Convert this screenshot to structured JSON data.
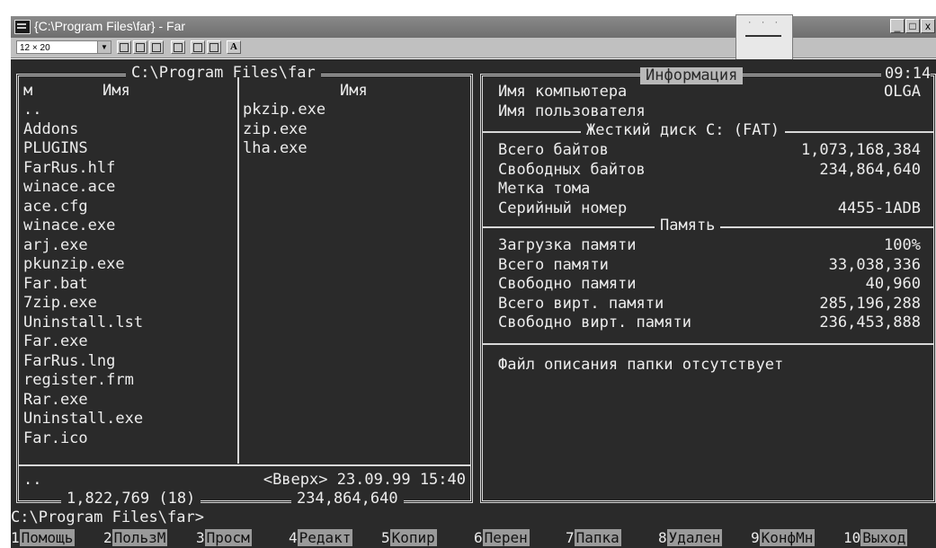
{
  "window": {
    "title": "{C:\\Program Files\\far} - Far",
    "minimize": "_",
    "maximize": "□",
    "close": "x"
  },
  "toolbar": {
    "font_size": "12 × 20"
  },
  "left_panel": {
    "title": "C:\\Program Files\\far",
    "col1_header_marker": "м",
    "col1_header": "Имя",
    "col2_header": "Имя",
    "col1_files": [
      "..",
      "Addons",
      "PLUGINS",
      "FarRus.hlf",
      "winace.ace",
      "ace.cfg",
      "winace.exe",
      "arj.exe",
      "pkunzip.exe",
      "Far.bat",
      "7zip.exe",
      "Uninstall.lst",
      "Far.exe",
      "FarRus.lng",
      "register.frm",
      "Rar.exe",
      "Uninstall.exe",
      "Far.ico"
    ],
    "col2_files": [
      "pkzip.exe",
      "zip.exe",
      "lha.exe"
    ],
    "status_name": "..",
    "status_info": "<Вверх> 23.09.99 15:40",
    "footer_total": "1,822,769 (18)",
    "footer_free": "234,864,640"
  },
  "right_panel": {
    "title": "Информация",
    "clock": "09:14",
    "computer_label": "Имя компьютера",
    "computer_value": "OLGA",
    "user_label": "Имя пользователя",
    "disk_section": "Жесткий диск C: (FAT)",
    "disk": [
      {
        "label": "Всего байтов",
        "value": "1,073,168,384"
      },
      {
        "label": "Свободных байтов",
        "value": "234,864,640"
      },
      {
        "label": "Метка тома",
        "value": ""
      },
      {
        "label": "Серийный номер",
        "value": "4455-1ADB"
      }
    ],
    "memory_section": "Память",
    "memory": [
      {
        "label": "Загрузка памяти",
        "value": "100%"
      },
      {
        "label": "Всего памяти",
        "value": "33,038,336"
      },
      {
        "label": "Свободно памяти",
        "value": "40,960"
      },
      {
        "label": "Всего вирт. памяти",
        "value": "285,196,288"
      },
      {
        "label": "Свободно вирт. памяти",
        "value": "236,453,888"
      }
    ],
    "description": "Файл описания папки отсутствует"
  },
  "command_line": "C:\\Program Files\\far>",
  "keybar": [
    {
      "num": "1",
      "label": "Помощь"
    },
    {
      "num": "2",
      "label": "ПользМ"
    },
    {
      "num": "3",
      "label": "Просм"
    },
    {
      "num": "4",
      "label": "Редакт"
    },
    {
      "num": "5",
      "label": "Копир"
    },
    {
      "num": "6",
      "label": "Перен"
    },
    {
      "num": "7",
      "label": "Папка"
    },
    {
      "num": "8",
      "label": "Удален"
    },
    {
      "num": "9",
      "label": "КонфМн"
    },
    {
      "num": "10",
      "label": "Выход"
    }
  ]
}
